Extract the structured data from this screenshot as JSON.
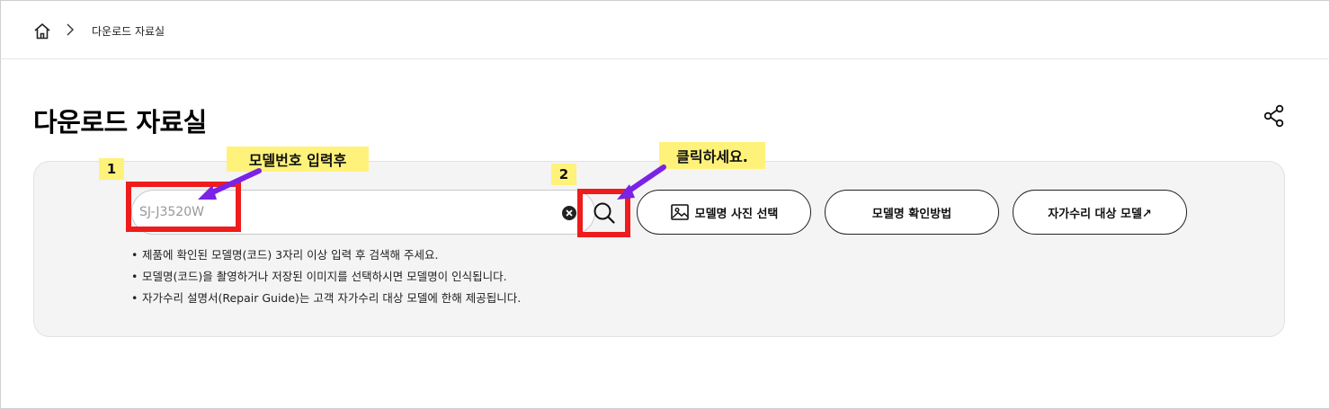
{
  "breadcrumb": {
    "home_icon": "home-icon",
    "separator_icon": "chevron-right-icon",
    "current": "다운로드 자료실"
  },
  "header": {
    "title": "다운로드 자료실",
    "share_icon": "share-icon"
  },
  "search": {
    "value": "SJ-J3520W",
    "clear_icon": "clear-circle-icon",
    "search_icon": "search-icon"
  },
  "buttons": {
    "photo_label": "모델명 사진 선택",
    "photo_icon": "image-icon",
    "howto_label": "모델명 확인방법",
    "diy_label": "자가수리 대상 모델↗"
  },
  "notes": [
    "제품에 확인된 모델명(코드) 3자리 이상 입력 후 검색해 주세요.",
    "모델명(코드)을 촬영하거나 저장된 이미지를 선택하시면 모델명이 인식됩니다.",
    "자가수리 설명서(Repair Guide)는 고객 자가수리 대상 모델에 한해 제공됩니다."
  ],
  "annotations": {
    "step1": "1",
    "step2": "2",
    "callout1": "모델번호 입력후",
    "callout2": "클릭하세요.",
    "highlight_color": "#fff27a",
    "box_color": "#ee1c1c",
    "arrow_color": "#7a22e6"
  }
}
